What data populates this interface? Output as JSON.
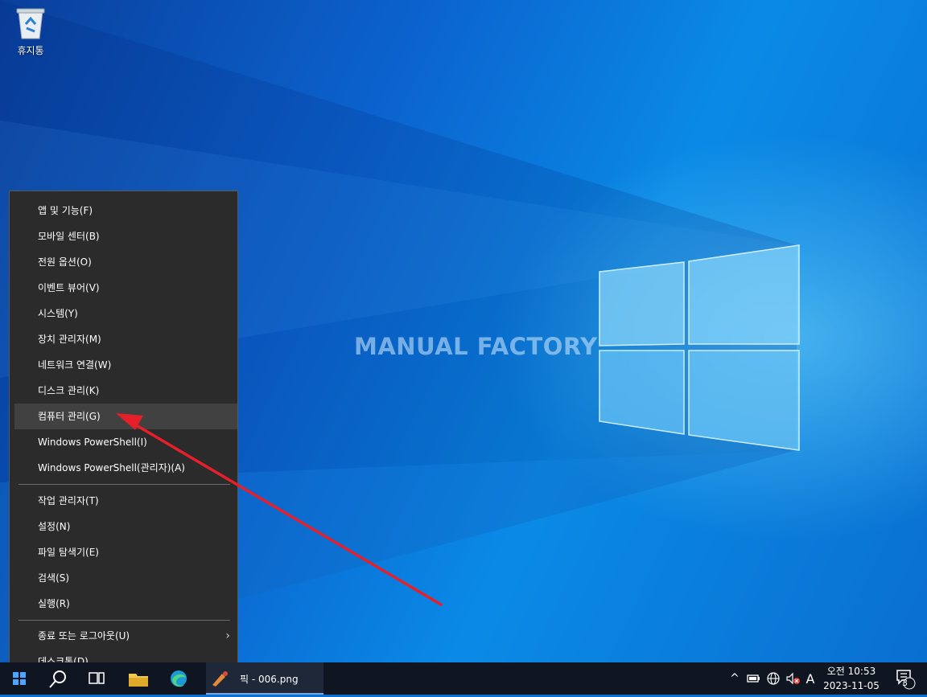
{
  "desktop": {
    "icons": [
      {
        "label": "휴지통",
        "icon": "recycle-bin-icon"
      }
    ],
    "watermark": "MANUAL FACTORY"
  },
  "menu": {
    "group1": [
      "앱 및 기능(F)",
      "모바일 센터(B)",
      "전원 옵션(O)",
      "이벤트 뷰어(V)",
      "시스템(Y)",
      "장치 관리자(M)",
      "네트워크 연결(W)",
      "디스크 관리(K)",
      "컴퓨터 관리(G)",
      "Windows PowerShell(I)",
      "Windows PowerShell(관리자)(A)"
    ],
    "group2": [
      "작업 관리자(T)",
      "설정(N)",
      "파일 탐색기(E)",
      "검색(S)",
      "실행(R)"
    ],
    "group3": [
      "종료 또는 로그아웃(U)",
      "데스크톱(D)"
    ],
    "highlighted": "컴퓨터 관리(G)",
    "submenu_indicator": "›"
  },
  "taskbar": {
    "active_window_title": "픽 - 006.png",
    "tray": {
      "overflow_arrow": "^",
      "input_indicator": "A",
      "notification_count": "3"
    },
    "clock": {
      "time": "오전 10:53",
      "date": "2023-11-05"
    }
  },
  "colors": {
    "menu_bg": "#2b2b2b",
    "menu_hover": "#414141",
    "taskbar_bg": "#101621",
    "annotation_arrow": "#e5202a"
  }
}
